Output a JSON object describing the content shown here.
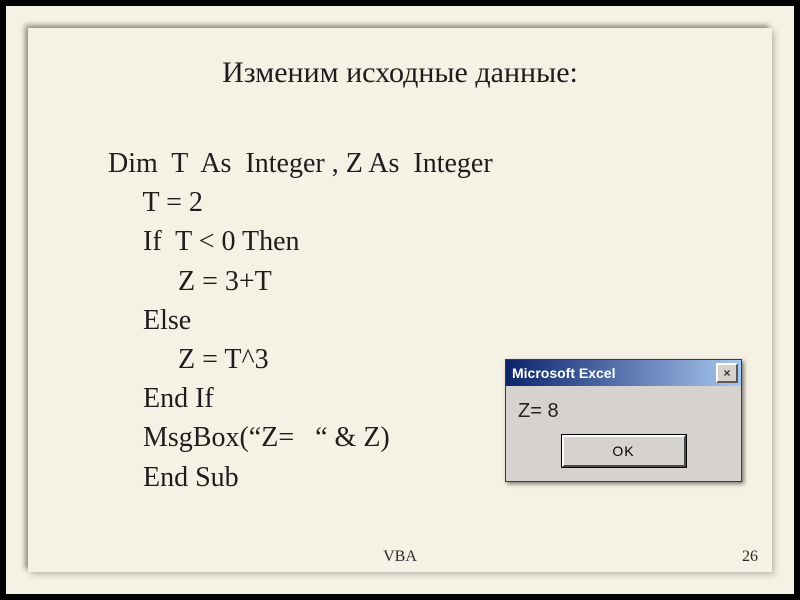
{
  "title": "Изменим исходные данные:",
  "code": {
    "l1": "Dim  T  As  Integer , Z As  Integer",
    "l2": "     T = 2",
    "l3": "     If  T < 0 Then",
    "l4": "          Z = 3+T",
    "l5": "     Else",
    "l6": "          Z = T^3",
    "l7": "     End If",
    "l8": "     MsgBox(“Z=   “ & Z)",
    "l9": "     End Sub"
  },
  "msgbox": {
    "title": "Microsoft Excel",
    "close": "×",
    "body": "Z= 8",
    "ok": "OK"
  },
  "footer": {
    "label": "VBA",
    "page": "26"
  }
}
